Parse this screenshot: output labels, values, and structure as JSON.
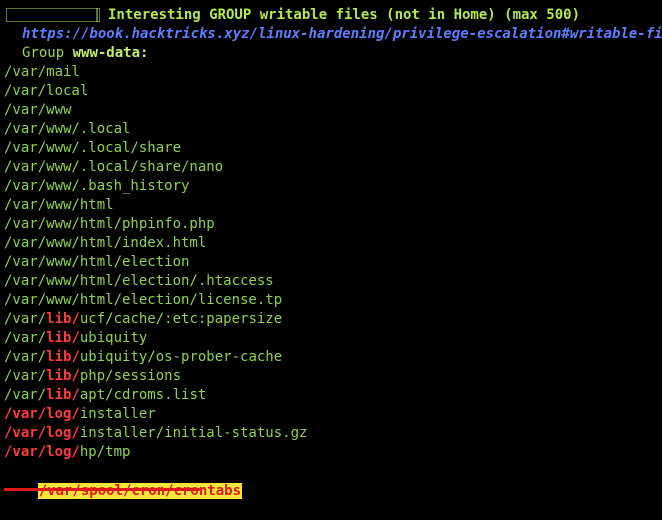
{
  "header": {
    "title": "Interesting GROUP writable files (not in Home) (max 500)",
    "url": "https://book.hacktricks.xyz/linux-hardening/privilege-escalation#writable-files",
    "group_label": "Group",
    "group_name": "www-data:"
  },
  "entries": [
    {
      "plain": "/var/mail"
    },
    {
      "plain": "/var/local"
    },
    {
      "plain": "/var/www"
    },
    {
      "plain": "/var/www/.local"
    },
    {
      "plain": "/var/www/.local/share"
    },
    {
      "plain": "/var/www/.local/share/nano"
    },
    {
      "plain": "/var/www/.bash_history"
    },
    {
      "plain": "/var/www/html"
    },
    {
      "plain": "/var/www/html/phpinfo.php"
    },
    {
      "plain": "/var/www/html/index.html"
    },
    {
      "plain": "/var/www/html/election"
    },
    {
      "plain": "/var/www/html/election/.htaccess"
    },
    {
      "plain": "/var/www/html/election/license.tp"
    },
    {
      "pre": "/var/",
      "red": "lib/",
      "post": "ucf/cache/:etc:papersize"
    },
    {
      "pre": "/var/",
      "red": "lib/",
      "post": "ubiquity"
    },
    {
      "pre": "/var/",
      "red": "lib/",
      "post": "ubiquity/os-prober-cache"
    },
    {
      "pre": "/var/",
      "red": "lib/",
      "post": "php/sessions"
    },
    {
      "pre": "/var/",
      "red": "lib/",
      "post": "apt/cdroms.list"
    },
    {
      "red_all": "/var/log/",
      "post": "installer"
    },
    {
      "red_all": "/var/log/",
      "post": "installer/initial-status.gz"
    },
    {
      "red_all": "/var/log/",
      "post": "hp/tmp"
    }
  ],
  "highlighted": "/var/spool/cron/crontabs",
  "colors": {
    "background": "#000000",
    "header": "#b5e853",
    "url": "#5f7dff",
    "path": "#8fd14f",
    "red": "#ff3b3b",
    "highlight_bg": "#f5e63a",
    "highlight_fg": "#e01818"
  }
}
